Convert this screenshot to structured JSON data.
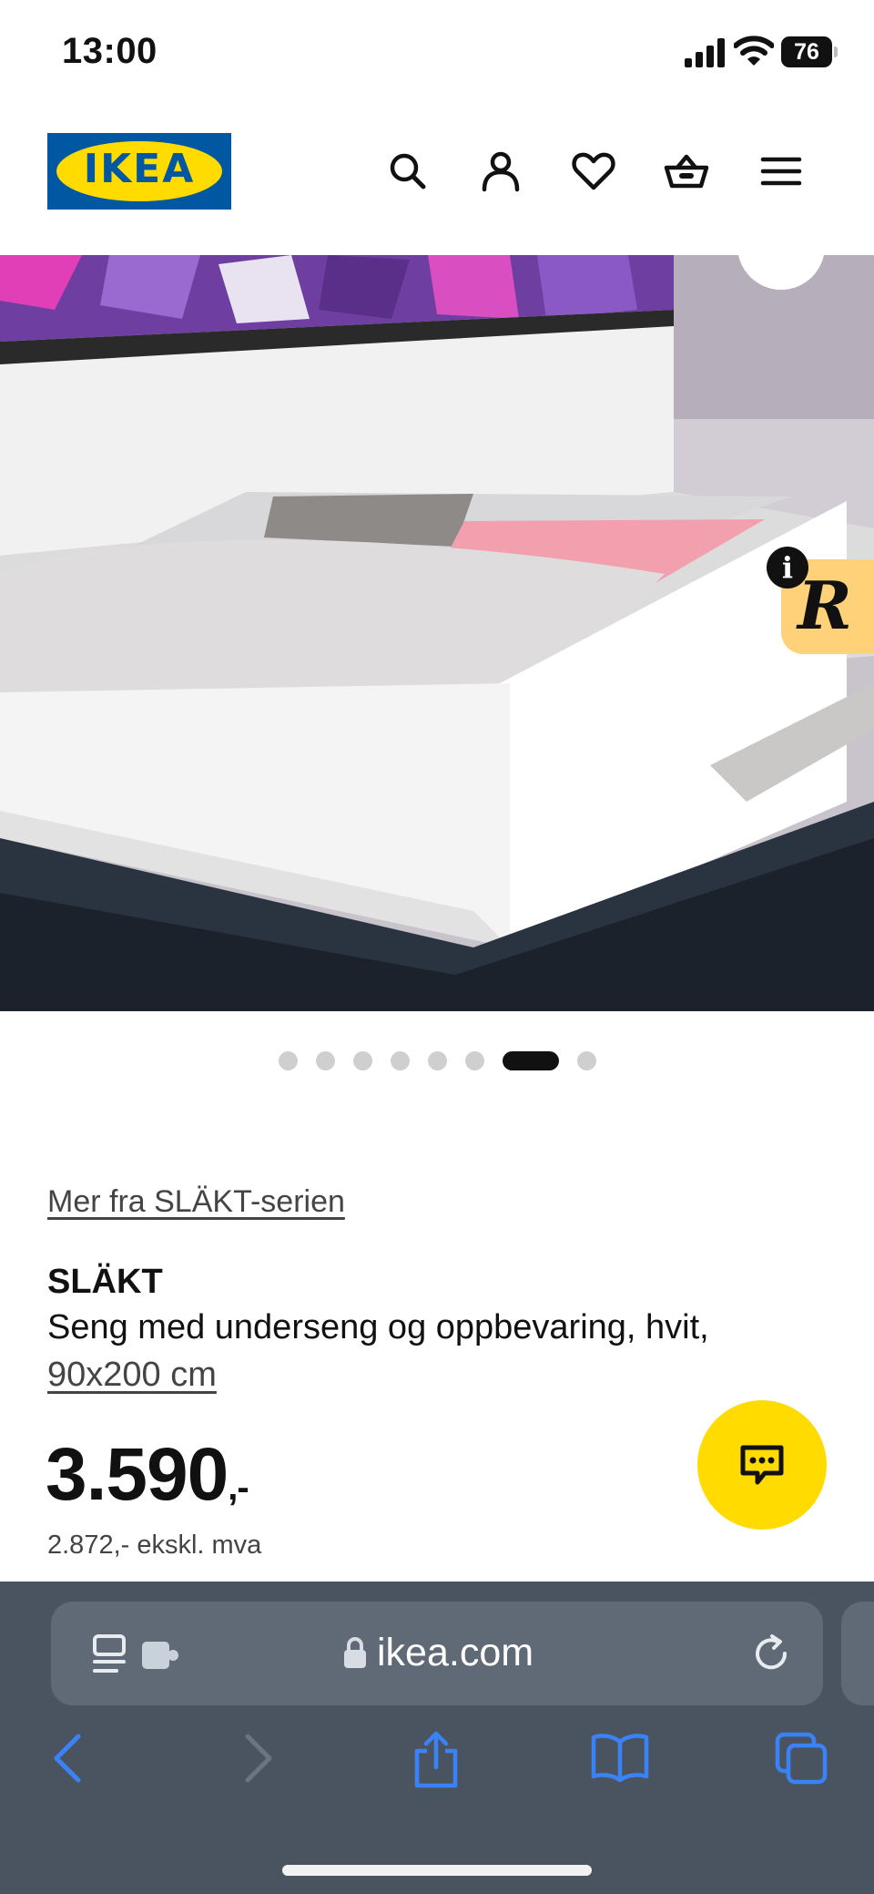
{
  "status_bar": {
    "time": "13:00",
    "battery": "76",
    "icons": [
      "cellular-signal-icon",
      "wifi-icon",
      "battery-icon"
    ]
  },
  "header": {
    "logo_text": "IKEA",
    "icons": [
      "search-icon",
      "account-icon",
      "heart-icon",
      "basket-icon",
      "menu-icon"
    ],
    "colors": {
      "logo_blue": "#0058a3",
      "logo_yellow": "#ffdb00"
    }
  },
  "gallery": {
    "dot_count": 8,
    "active_index": 6,
    "rebuy_badge": "R",
    "info_badge": "i"
  },
  "product": {
    "series_link": "Mer fra SLÄKT-serien",
    "name": "SLÄKT",
    "description": "Seng med underseng og oppbevaring, hvit,",
    "size": "90x200 cm",
    "price": "3.590",
    "price_suffix": ",-",
    "price_ex_vat": "2.872,- ekskl. mva",
    "chat_icon": "chat-icon",
    "chat_color": "#ffdb00"
  },
  "browser": {
    "url": "ikea.com",
    "icons": [
      "reader-icon",
      "extension-icon",
      "lock-icon",
      "reload-icon",
      "back-icon",
      "forward-icon",
      "share-icon",
      "bookmarks-icon",
      "tabs-icon"
    ],
    "accent": "#3a82f7"
  }
}
